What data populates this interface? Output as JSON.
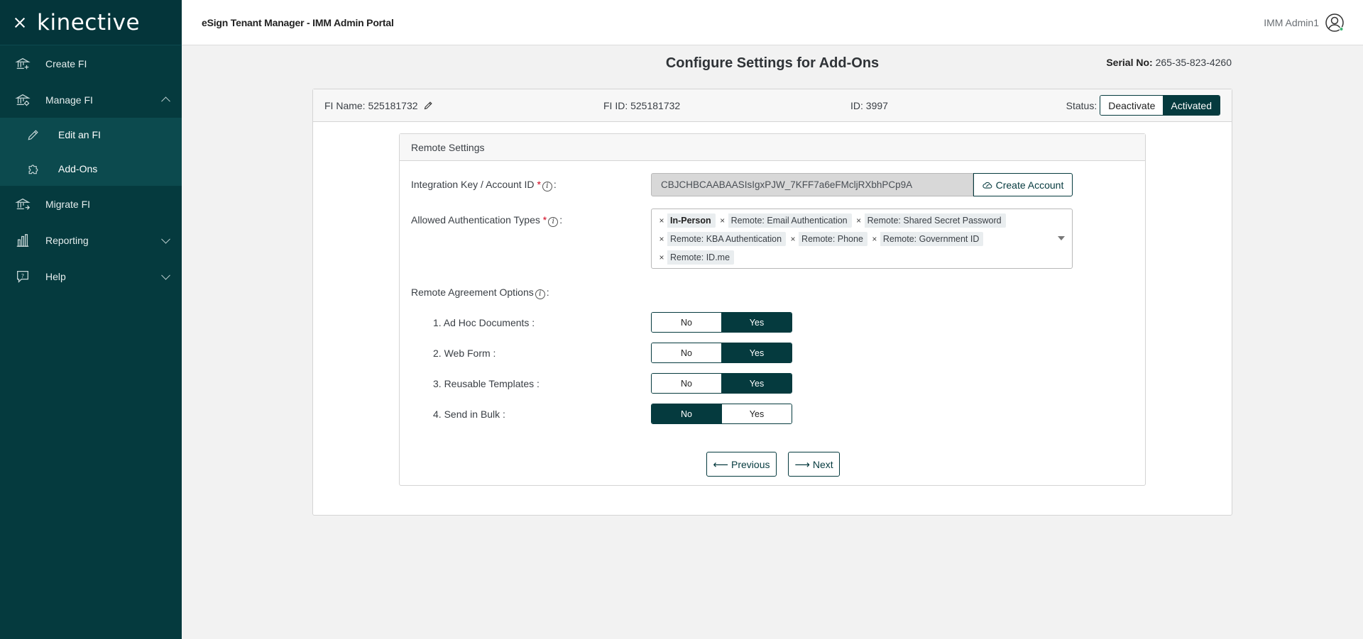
{
  "brand": {
    "logo_text": "kinective"
  },
  "header": {
    "title": "eSign Tenant Manager - IMM Admin Portal",
    "user_name": "IMM Admin1"
  },
  "sidebar": {
    "items": [
      {
        "label": "Create FI",
        "icon": "bank-plus-icon"
      },
      {
        "label": "Manage FI",
        "icon": "bank-gear-icon",
        "expanded": true,
        "subitems": [
          {
            "label": "Edit an FI",
            "icon": "pencil-icon"
          },
          {
            "label": "Add-Ons",
            "icon": "puzzle-icon"
          }
        ]
      },
      {
        "label": "Migrate FI",
        "icon": "bank-arrow-icon"
      },
      {
        "label": "Reporting",
        "icon": "bar-chart-icon",
        "expanded": false
      },
      {
        "label": "Help",
        "icon": "help-bubble-icon",
        "expanded": false
      }
    ]
  },
  "page": {
    "title": "Configure Settings for Add-Ons",
    "serial_label": "Serial No:",
    "serial_value": "265-35-823-4260"
  },
  "fi": {
    "name_text": "FI Name: 525181732",
    "id_text": "FI ID: 525181732",
    "record_id_text": "ID: 3997",
    "status_label": "Status:",
    "status_options": [
      "Deactivate",
      "Activated"
    ],
    "status_selected": "Activated"
  },
  "remote": {
    "section_title": "Remote Settings",
    "integration_label": "Integration Key / Account ID",
    "integration_value": "CBJCHBCAABAASIsIgxPJW_7KFF7a6eFMcljRXbhPCp9A",
    "create_account_label": "Create Account",
    "auth_label": "Allowed Authentication Types",
    "auth_types": [
      "In-Person",
      "Remote: Email Authentication",
      "Remote: Shared Secret Password",
      "Remote: KBA Authentication",
      "Remote: Phone",
      "Remote: Government ID",
      "Remote: ID.me"
    ],
    "agreement_label": "Remote Agreement Options",
    "options": [
      {
        "label": "1. Ad Hoc Documents :",
        "value": "Yes"
      },
      {
        "label": "2. Web Form :",
        "value": "Yes"
      },
      {
        "label": "3. Reusable Templates :",
        "value": "Yes"
      },
      {
        "label": "4. Send in Bulk :",
        "value": "No"
      }
    ],
    "no_label": "No",
    "yes_label": "Yes",
    "previous_label": "Previous",
    "next_label": "Next"
  },
  "colors": {
    "sidebar_bg": "#053a3e",
    "accent": "#053a3e",
    "required": "#d0021b"
  }
}
